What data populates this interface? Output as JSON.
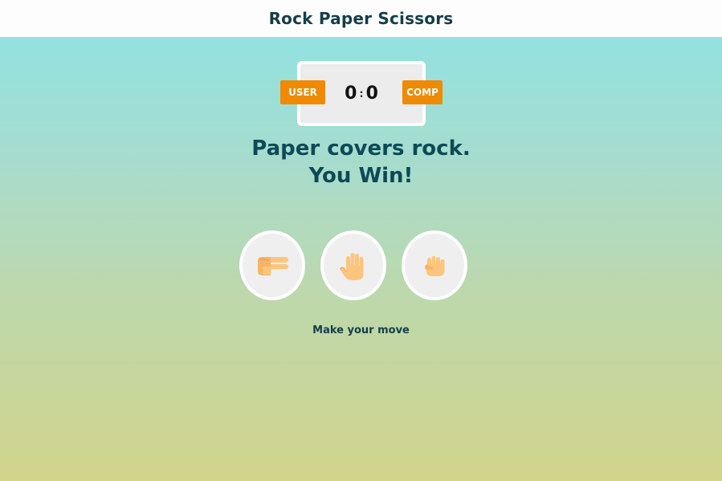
{
  "header": {
    "title": "Rock Paper Scissors"
  },
  "scoreboard": {
    "user_label": "USER",
    "comp_label": "COMP",
    "user_score": "0",
    "separator": ":",
    "comp_score": "0"
  },
  "result": {
    "line1": "Paper covers rock.",
    "line2": "You Win!"
  },
  "choices": [
    {
      "name": "scissors",
      "icon": "scissors-hand-icon"
    },
    {
      "name": "paper",
      "icon": "paper-hand-icon"
    },
    {
      "name": "rock",
      "icon": "rock-fist-icon"
    }
  ],
  "prompt": "Make your move",
  "colors": {
    "header_bg": "#fdfdfd",
    "badge": "#ee8a04",
    "text_dark": "#153d4a",
    "result_text": "#0d4a57",
    "hand": "#fcc57e"
  }
}
